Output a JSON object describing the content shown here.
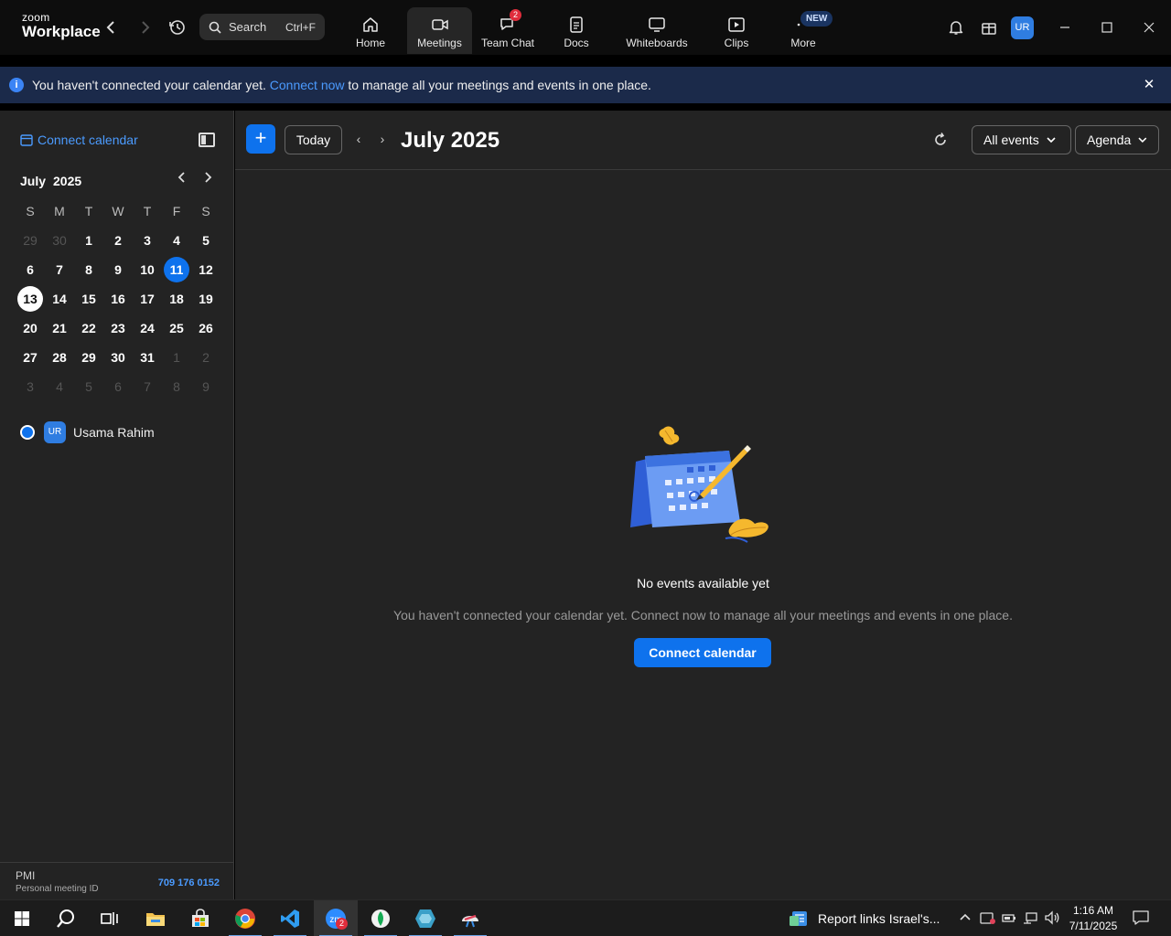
{
  "app": {
    "logo_small": "zoom",
    "logo_big": "Workplace"
  },
  "search": {
    "label": "Search",
    "shortcut": "Ctrl+F"
  },
  "nav": {
    "tabs": [
      {
        "label": "Home",
        "icon": "home-icon"
      },
      {
        "label": "Meetings",
        "icon": "video-icon",
        "active": true
      },
      {
        "label": "Team Chat",
        "icon": "chat-icon",
        "badge": "2"
      },
      {
        "label": "Docs",
        "icon": "docs-icon"
      },
      {
        "label": "Whiteboards",
        "icon": "whiteboard-icon"
      },
      {
        "label": "Clips",
        "icon": "clips-icon"
      },
      {
        "label": "More",
        "icon": "more-icon",
        "badge": "NEW"
      }
    ],
    "avatar": "UR"
  },
  "banner": {
    "text_before": "You haven't connected your calendar yet.",
    "link": "Connect now",
    "text_after": "to manage all your meetings and events in one place."
  },
  "sidebar": {
    "connect_label": "Connect calendar",
    "mini_month": "July",
    "mini_year": "2025",
    "weekdays": [
      "S",
      "M",
      "T",
      "W",
      "T",
      "F",
      "S"
    ],
    "weeks": [
      [
        "29",
        "30",
        "1",
        "2",
        "3",
        "4",
        "5"
      ],
      [
        "6",
        "7",
        "8",
        "9",
        "10",
        "11",
        "12"
      ],
      [
        "13",
        "14",
        "15",
        "16",
        "17",
        "18",
        "19"
      ],
      [
        "20",
        "21",
        "22",
        "23",
        "24",
        "25",
        "26"
      ],
      [
        "27",
        "28",
        "29",
        "30",
        "31",
        "1",
        "2"
      ],
      [
        "3",
        "4",
        "5",
        "6",
        "7",
        "8",
        "9"
      ]
    ],
    "selected_day": "11",
    "today_day": "13",
    "user_initials": "UR",
    "user_name": "Usama Rahim",
    "pmi_label": "PMI",
    "pmi_sub": "Personal meeting ID",
    "pmi_id": "709 176 0152"
  },
  "main": {
    "today_label": "Today",
    "title": "July 2025",
    "filter_label": "All events",
    "view_label": "Agenda",
    "empty_title": "No events available yet",
    "empty_sub": "You haven't connected your calendar yet. Connect now to manage all your meetings and events in one place.",
    "connect_button": "Connect calendar"
  },
  "taskbar": {
    "zoom_badge": "2",
    "report_label": "Report links Israel's...",
    "time": "1:16 AM",
    "date": "7/11/2025"
  },
  "colors": {
    "accent": "#0e72ed",
    "link": "#4b9bff",
    "banner_bg": "#1b2a4a",
    "panel_bg": "#232323",
    "badge_red": "#e02d3c"
  }
}
